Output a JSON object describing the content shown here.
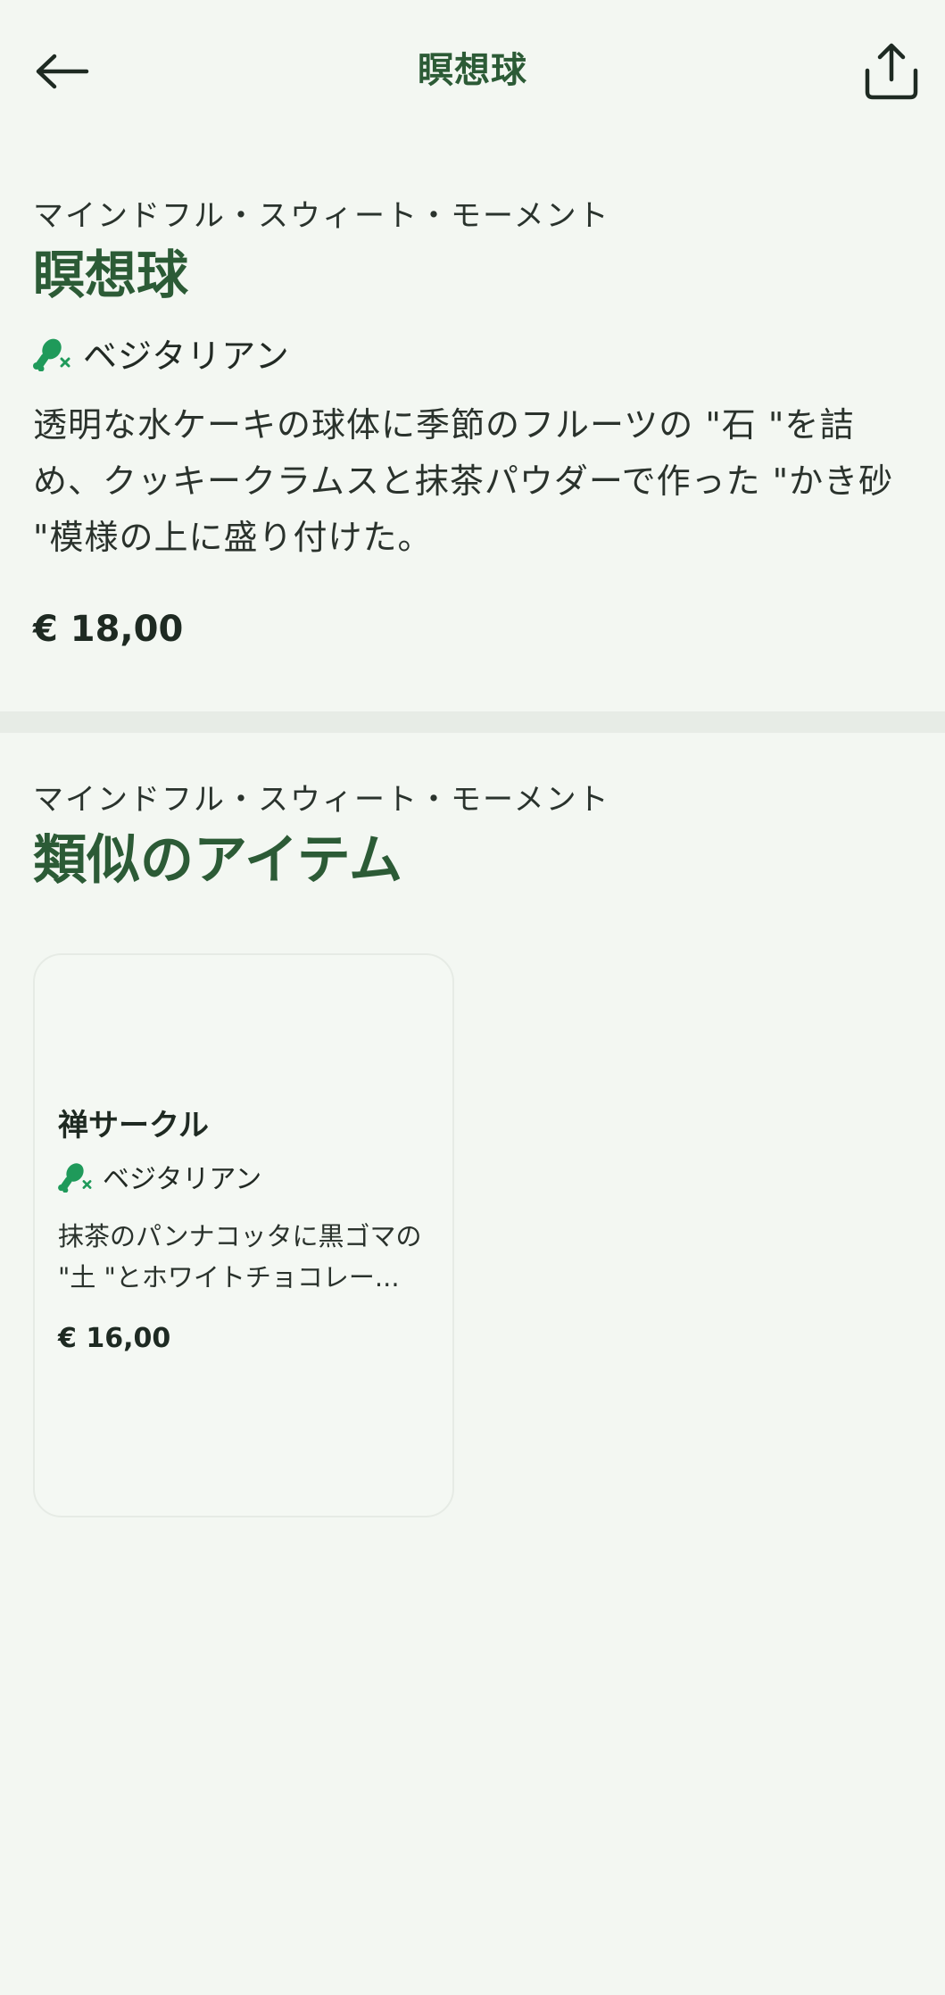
{
  "header": {
    "title": "瞑想球",
    "back_icon": "arrow-left-icon",
    "share_icon": "share-upload-icon"
  },
  "product": {
    "category": "マインドフル・スウィート・モーメント",
    "name": "瞑想球",
    "diet_label": "ベジタリアン",
    "diet_icon": "vegetarian-drumstick-icon",
    "description": "透明な水ケーキの球体に季節のフルーツの \"石 \"を詰め、クッキークラムスと抹茶パウダーで作った \"かき砂 \"模様の上に盛り付けた。",
    "price": "€ 18,00"
  },
  "similar": {
    "category": "マインドフル・スウィート・モーメント",
    "heading": "類似のアイテム",
    "items": [
      {
        "name": "禅サークル",
        "diet_label": "ベジタリアン",
        "description": "抹茶のパンナコッタに黒ゴマの \"土 \"とホワイトチョコレー...",
        "price": "€ 16,00"
      }
    ]
  },
  "colors": {
    "background": "#f3f7f2",
    "accent_green": "#2c5b36",
    "icon_green": "#1f9a5a",
    "divider": "#e7ece6"
  }
}
